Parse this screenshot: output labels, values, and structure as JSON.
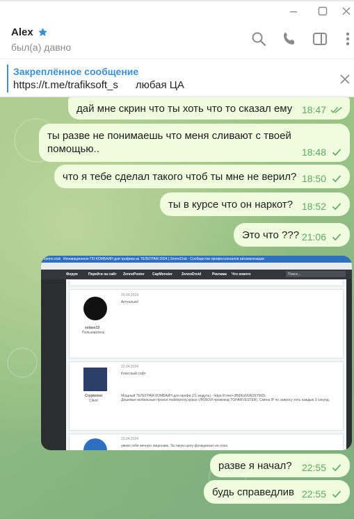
{
  "window": {
    "controls": [
      "minimize-icon",
      "maximize-icon",
      "close-icon"
    ]
  },
  "header": {
    "name": "Alex",
    "status": "был(а) давно",
    "icons": [
      "star-icon",
      "search-icon",
      "phone-icon",
      "sidebar-icon",
      "more-icon"
    ]
  },
  "pinned": {
    "title": "Закреплённое сообщение",
    "text": "https://t.me/trafiksoft_s      любая ЦА"
  },
  "messages": [
    {
      "text": "дай мне скрин что ты хоть что то сказал ему",
      "time": "18:47",
      "read": true
    },
    {
      "text": "ты разве не понимаешь что меня сливают с твоей",
      "text2": "помощью..",
      "time": "18:48",
      "read": false
    },
    {
      "text": "что я тебе сделал такого чтоб ты мне не верил?",
      "time": "18:50",
      "read": false
    },
    {
      "text": "ты в курсе что он наркот?",
      "time": "18:52",
      "read": false
    },
    {
      "text": "Это что ???",
      "time": "21:06",
      "read": false
    },
    {
      "text": "разве я начал?",
      "time": "22:55",
      "read": false
    },
    {
      "text": "будь справедлив",
      "time": "22:55",
      "read": false
    }
  ],
  "screenshot": {
    "tab_title": "Инновационное ПО КОМБАЙН для трафика из ТЕЛЕГРАМ 2024 | ZennoClub - Сообщество профессионалов автоматизации",
    "site": "zenno.club",
    "nav": [
      "Форум",
      "Перейти на сайт",
      "ZennoPoster",
      "CapMonster",
      "ZennoDroid",
      "Реклама",
      "Что нового"
    ],
    "search": "Поиск...",
    "posts": [
      {
        "user": "",
        "date": "",
        "text": ""
      },
      {
        "user": "sstass13",
        "role": "Пользователь",
        "date": "20.04.2024",
        "text": "Актуально!"
      },
      {
        "user": "Cryptonist",
        "role": "Client",
        "date": "22.04.2024",
        "text": "Классный софт",
        "promo": "Мощный ТЕЛЕГРАМ КОМБАЙН для профи (21 модуль) - https://t.me/+3Bj0KxNVAS5YMZb",
        "promo2": "Дешевые мобильные прокси mobileproxy.space (ЛЮБОЙ промокод TGHARVESTER). Сменa IP по запросу хоть каждые 3 секунд."
      },
      {
        "user": "",
        "date": "23.04.2024",
        "text": "увеил себе вечную лицензию. За такую цену функционал не плох."
      }
    ]
  },
  "colors": {
    "accent": "#3a8fd0",
    "bubble": "#effdde",
    "meta": "#5fa760"
  }
}
